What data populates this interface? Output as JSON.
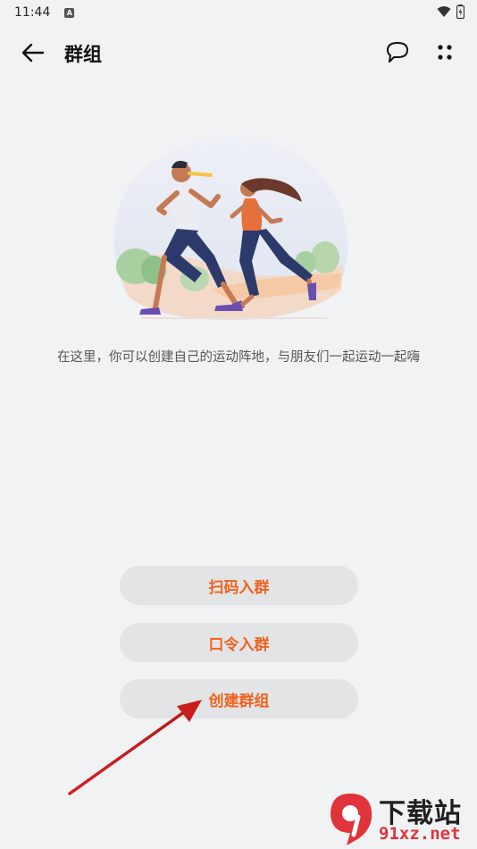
{
  "status_bar": {
    "time": "11:44",
    "app_icon_letter": "A"
  },
  "header": {
    "title": "群组"
  },
  "content": {
    "description": "在这里，你可以创建自己的运动阵地，与朋友们一起运动一起嗨"
  },
  "actions": {
    "scan_label": "扫码入群",
    "password_label": "口令入群",
    "create_label": "创建群组"
  },
  "watermark": {
    "line1": "下载站",
    "line2": "91xz.net"
  },
  "colors": {
    "accent": "#f0621d",
    "background": "#f1f2f4",
    "button_bg": "#e3e4e6"
  },
  "icons": [
    "back-arrow-icon",
    "chat-bubble-icon",
    "more-dots-icon",
    "wifi-icon",
    "battery-icon"
  ]
}
